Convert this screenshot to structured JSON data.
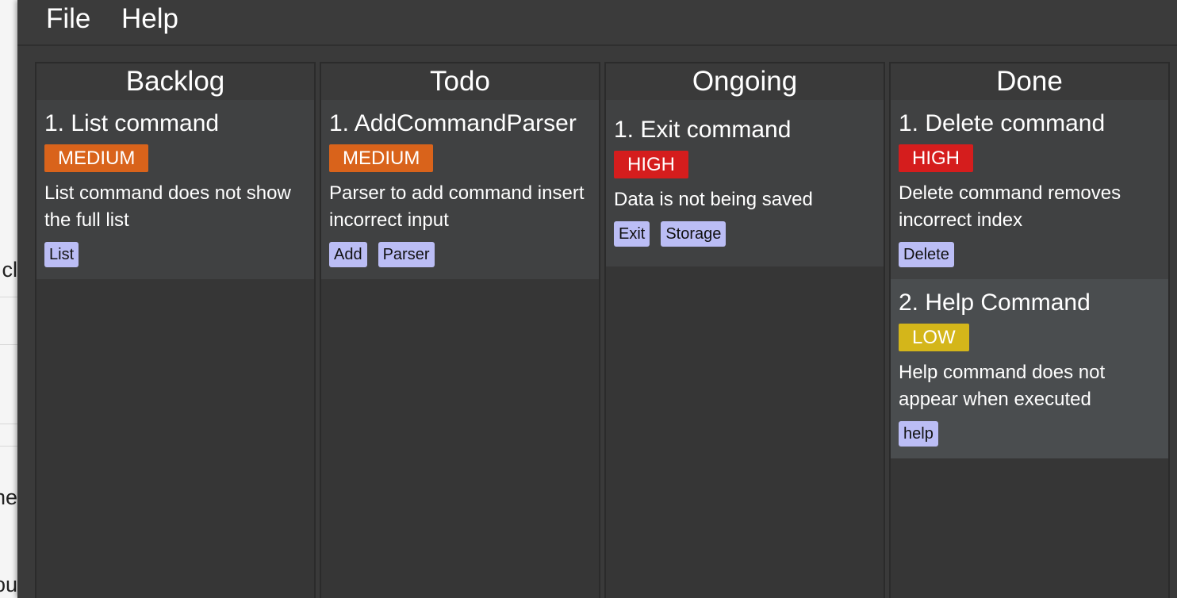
{
  "menu": {
    "file": "File",
    "help": "Help"
  },
  "background_window": {
    "snippets": [
      "cl",
      "ne",
      "ou"
    ]
  },
  "priority_colors": {
    "HIGH": "#d51d1d",
    "MEDIUM": "#d9631b",
    "LOW": "#d4b61a"
  },
  "columns": [
    {
      "title": "Backlog",
      "cards": [
        {
          "title": "1. List command",
          "priority": "MEDIUM",
          "description": "List command does not show the full list",
          "tags": [
            "List"
          ]
        }
      ]
    },
    {
      "title": "Todo",
      "cards": [
        {
          "title": "1. AddCommandParser",
          "priority": "MEDIUM",
          "description": "Parser to add command insert incorrect input",
          "tags": [
            "Add",
            "Parser"
          ]
        }
      ]
    },
    {
      "title": "Ongoing",
      "cards": [
        {
          "title": "1. Exit command",
          "priority": "HIGH",
          "description": "Data is not being saved",
          "tags": [
            "Exit",
            "Storage"
          ]
        }
      ]
    },
    {
      "title": "Done",
      "cards": [
        {
          "title": "1. Delete command",
          "priority": "HIGH",
          "description": "Delete command removes incorrect index",
          "tags": [
            "Delete"
          ]
        },
        {
          "title": "2. Help Command",
          "priority": "LOW",
          "description": "Help command does not appear when executed",
          "tags": [
            "help"
          ]
        }
      ]
    }
  ]
}
